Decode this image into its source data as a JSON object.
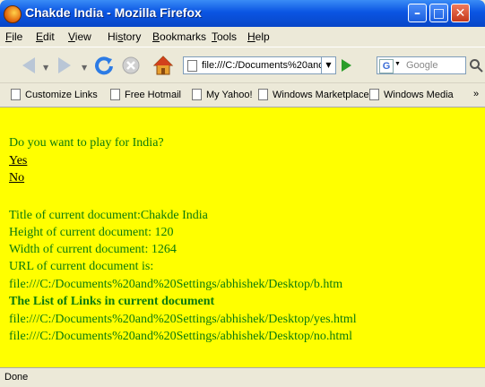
{
  "window": {
    "title": "Chakde India - Mozilla Firefox"
  },
  "menu": [
    {
      "accel": "F",
      "rest": "ile"
    },
    {
      "accel": "E",
      "rest": "dit"
    },
    {
      "accel": "V",
      "rest": "iew"
    },
    {
      "pre": "Hi",
      "accel": "s",
      "rest": "tory"
    },
    {
      "accel": "B",
      "rest": "ookmarks"
    },
    {
      "accel": "T",
      "rest": "ools"
    },
    {
      "accel": "H",
      "rest": "elp"
    }
  ],
  "nav": {
    "url": "file:///C:/Documents%20and%",
    "search_placeholder": "Google"
  },
  "bookmarks": [
    "Customize Links",
    "Free Hotmail",
    "My Yahoo!",
    "Windows Marketplace",
    "Windows Media"
  ],
  "bookmarks_overflow": "»",
  "content": {
    "question": "Do you want to play for India?",
    "yes_link": "Yes",
    "no_link": "No",
    "title_line": "Title of current document:Chakde India",
    "height_line": "Height of current document: 120",
    "width_line": "Width of current document: 1264",
    "url_label": "URL of current document is:",
    "url_value": "file:///C:/Documents%20and%20Settings/abhishek/Desktop/b.htm",
    "links_heading": "The List of Links in current document",
    "links": [
      "file:///C:/Documents%20and%20Settings/abhishek/Desktop/yes.html",
      "file:///C:/Documents%20and%20Settings/abhishek/Desktop/no.html"
    ]
  },
  "status": "Done",
  "colors": {
    "page_bg": "#ffff00",
    "text": "#0c7a0c",
    "titlebar": "#0a55e3"
  },
  "icons": [
    "firefox-logo-icon",
    "minimize-icon",
    "maximize-icon",
    "close-icon",
    "back-arrow-icon",
    "forward-arrow-icon",
    "reload-icon",
    "stop-icon",
    "home-icon",
    "go-icon",
    "google-icon",
    "search-icon",
    "page-icon"
  ]
}
